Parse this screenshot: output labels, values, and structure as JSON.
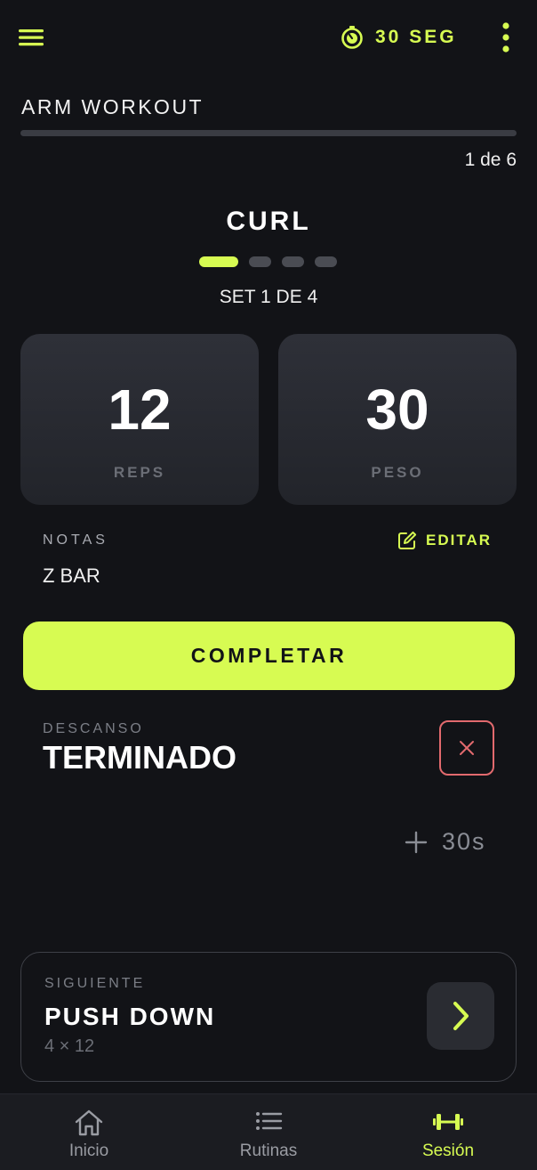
{
  "header": {
    "timer_text": "30 SEG"
  },
  "workout": {
    "title": "ARM WORKOUT",
    "progress_text": "1 de 6",
    "progress_fraction": 0.1667
  },
  "exercise": {
    "name": "CURL",
    "sets_total": 4,
    "current_set": 1,
    "set_label": "SET 1 DE 4"
  },
  "stats": {
    "reps_value": "12",
    "reps_label": "REPS",
    "peso_value": "30",
    "peso_label": "PESO"
  },
  "notes": {
    "label": "NOTAS",
    "edit_label": "EDITAR",
    "value": "Z BAR"
  },
  "actions": {
    "complete_label": "COMPLETAR"
  },
  "rest": {
    "label": "DESCANSO",
    "status": "TERMINADO",
    "add_time_label": "30s"
  },
  "next": {
    "label": "SIGUIENTE",
    "name": "PUSH DOWN",
    "scheme": "4 × 12"
  },
  "nav": {
    "items": [
      {
        "label": "Inicio",
        "icon": "home-icon"
      },
      {
        "label": "Rutinas",
        "icon": "list-icon"
      },
      {
        "label": "Sesión",
        "icon": "dumbbell-icon",
        "active": true
      }
    ]
  },
  "colors": {
    "accent": "#d7fb52",
    "background": "#121317",
    "danger": "#e26a6e"
  }
}
